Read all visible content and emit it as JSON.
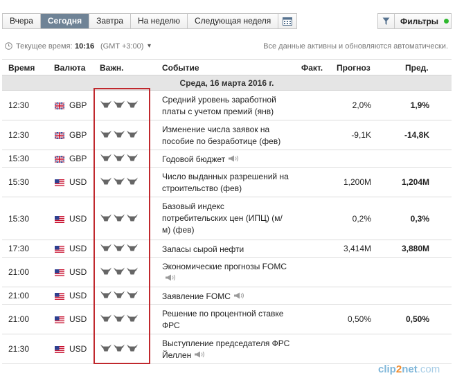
{
  "tabs": [
    {
      "label": "Вчера",
      "active": false
    },
    {
      "label": "Сегодня",
      "active": true
    },
    {
      "label": "Завтра",
      "active": false
    },
    {
      "label": "На неделю",
      "active": false
    },
    {
      "label": "Следующая неделя",
      "active": false
    }
  ],
  "filters_label": "Фильтры",
  "timebar": {
    "label": "Текущее время:",
    "time": "10:16",
    "timezone": "(GMT +3:00)",
    "note": "Все данные активны и обновляются автоматически."
  },
  "headers": {
    "time": "Время",
    "currency": "Валюта",
    "importance": "Важн.",
    "event": "Событие",
    "actual": "Факт.",
    "forecast": "Прогноз",
    "previous": "Пред."
  },
  "day_label": "Среда, 16 марта 2016 г.",
  "rows": [
    {
      "time": "12:30",
      "currency": "GBP",
      "flag": "uk",
      "importance": 3,
      "event": "Средний уровень заработной платы с учетом премий (янв)",
      "speech": false,
      "forecast": "2,0%",
      "previous": "1,9%"
    },
    {
      "time": "12:30",
      "currency": "GBP",
      "flag": "uk",
      "importance": 3,
      "event": "Изменение числа заявок на пособие по безработице (фев)",
      "speech": false,
      "forecast": "-9,1K",
      "previous": "-14,8K"
    },
    {
      "time": "15:30",
      "currency": "GBP",
      "flag": "uk",
      "importance": 3,
      "event": "Годовой бюджет",
      "speech": true,
      "forecast": "",
      "previous": ""
    },
    {
      "time": "15:30",
      "currency": "USD",
      "flag": "us",
      "importance": 3,
      "event": "Число выданных разрешений на строительство (фев)",
      "speech": false,
      "forecast": "1,200M",
      "previous": "1,204M"
    },
    {
      "time": "15:30",
      "currency": "USD",
      "flag": "us",
      "importance": 3,
      "event": "Базовый индекс потребительских цен (ИПЦ) (м/м) (фев)",
      "speech": false,
      "forecast": "0,2%",
      "previous": "0,3%"
    },
    {
      "time": "17:30",
      "currency": "USD",
      "flag": "us",
      "importance": 3,
      "event": "Запасы сырой нефти",
      "speech": false,
      "forecast": "3,414M",
      "previous": "3,880M"
    },
    {
      "time": "21:00",
      "currency": "USD",
      "flag": "us",
      "importance": 3,
      "event": "Экономические прогнозы FOMC",
      "speech": true,
      "forecast": "",
      "previous": ""
    },
    {
      "time": "21:00",
      "currency": "USD",
      "flag": "us",
      "importance": 3,
      "event": "Заявление FOMC",
      "speech": true,
      "forecast": "",
      "previous": ""
    },
    {
      "time": "21:00",
      "currency": "USD",
      "flag": "us",
      "importance": 3,
      "event": "Решение по процентной ставке ФРС",
      "speech": false,
      "forecast": "0,50%",
      "previous": "0,50%"
    },
    {
      "time": "21:30",
      "currency": "USD",
      "flag": "us",
      "importance": 3,
      "event": "Выступление председателя ФРС Йеллен",
      "speech": true,
      "forecast": "",
      "previous": ""
    }
  ],
  "watermark": {
    "part1": "clip",
    "part2": "2",
    "part3": "net",
    "part4": ".com"
  },
  "colors": {
    "active_tab": "#6f8396",
    "highlight": "#c0282d",
    "status_dot": "#2eb82e"
  },
  "icons": {
    "calendar": "calendar-icon",
    "filter": "filter-icon",
    "clock": "clock-icon",
    "importance": "bull-icon",
    "speech": "speaker-icon"
  }
}
